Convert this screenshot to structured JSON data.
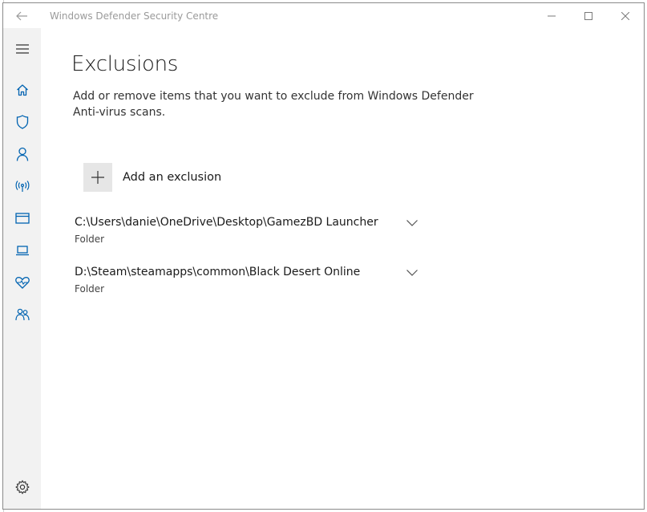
{
  "window": {
    "title": "Windows Defender Security Centre"
  },
  "sidebar": {
    "items": [
      {
        "icon": "hamburger-menu-icon"
      },
      {
        "icon": "home-icon"
      },
      {
        "icon": "shield-icon"
      },
      {
        "icon": "person-icon"
      },
      {
        "icon": "wireless-icon"
      },
      {
        "icon": "app-browser-icon"
      },
      {
        "icon": "laptop-icon"
      },
      {
        "icon": "heart-icon"
      },
      {
        "icon": "family-icon"
      },
      {
        "icon": "gear-icon"
      }
    ]
  },
  "main": {
    "title": "Exclusions",
    "description": "Add or remove items that you want to exclude from Windows Defender Anti-virus scans.",
    "add_label": "Add an exclusion",
    "exclusions": [
      {
        "path": "C:\\Users\\danie\\OneDrive\\Desktop\\GamezBD Launcher",
        "type": "Folder"
      },
      {
        "path": "D:\\Steam\\steamapps\\common\\Black Desert Online",
        "type": "Folder"
      }
    ]
  },
  "colors": {
    "accent": "#0063b1",
    "sidebar_bg": "#f2f2f2",
    "add_button_bg": "#e6e6e6"
  }
}
